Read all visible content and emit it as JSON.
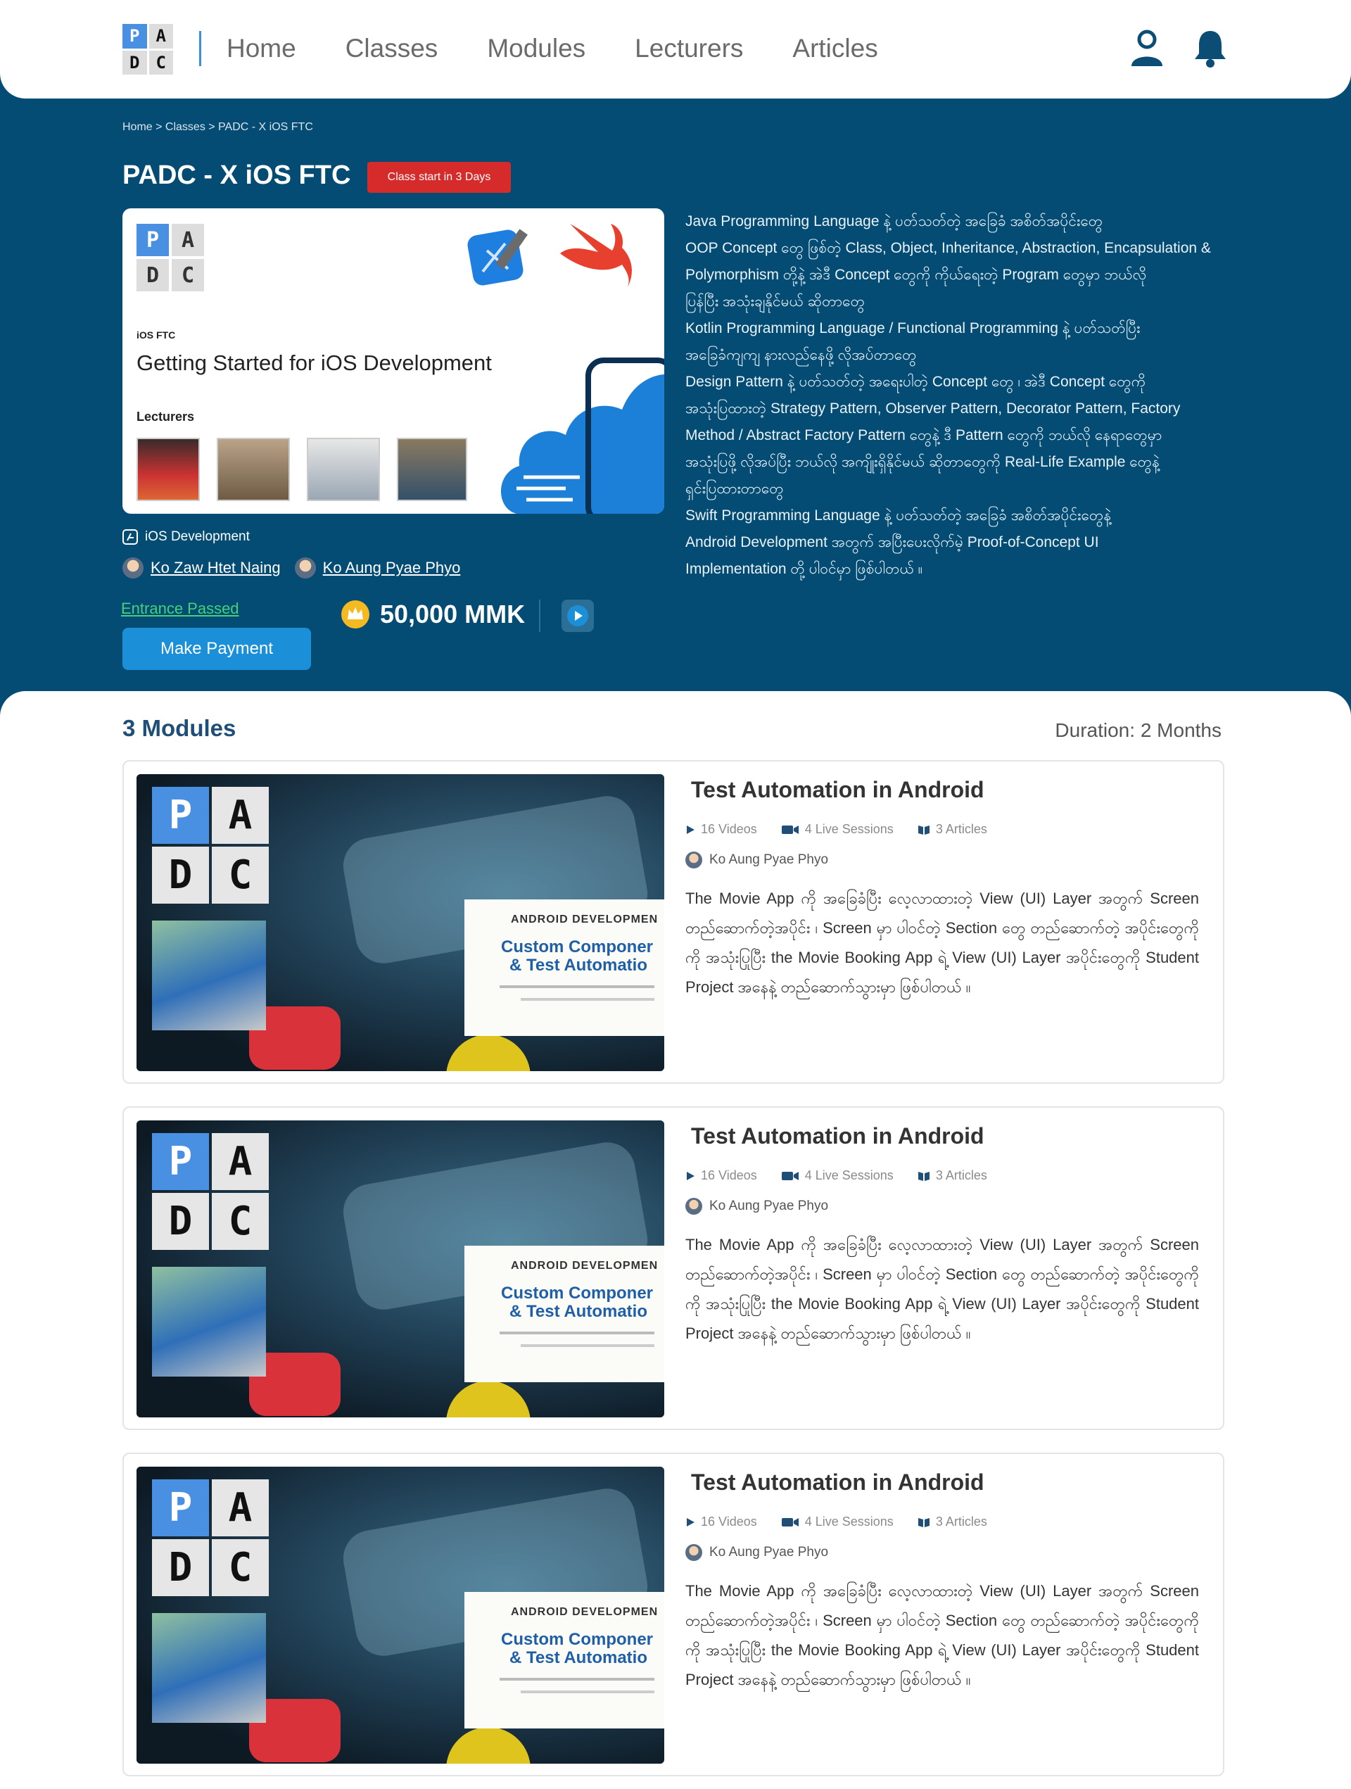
{
  "nav": {
    "logo_letters": [
      "P",
      "A",
      "D",
      "C"
    ],
    "items": [
      "Home",
      "Classes",
      "Modules",
      "Lecturers",
      "Articles"
    ],
    "profile_icon": "user-icon",
    "notification_icon": "bell-icon"
  },
  "breadcrumb": "Home > Classes > PADC - X iOS FTC",
  "class": {
    "title": "PADC - X iOS FTC",
    "badge": "Class start in 3 Days",
    "cover": {
      "subtitle": "iOS FTC",
      "title": "Getting Started for iOS Development",
      "lecturers_heading": "Lecturers"
    },
    "description_lines": [
      "Java Programming Language နဲ့ ပတ်သတ်တဲ့ အခြေခံ အစိတ်အပိုင်းတွေ",
      "OOP Concept တွေ ဖြစ်တဲ့ Class, Object, Inheritance, Abstraction, Encapsulation &",
      "Polymorphism တို့နဲ့ အဲဒီ Concept တွေကို ကိုယ်ရေးတဲ့ Program တွေမှာ ဘယ်လို",
      "ပြန်ပြီး အသုံးချနိုင်မယ် ဆိုတာတွေ",
      "Kotlin Programming Language / Functional Programming နဲ့ ပတ်သတ်ပြီး",
      "အခြေခံကျကျ နားလည်နေဖို့ လိုအပ်တာတွေ",
      "Design Pattern နဲ့ ပတ်သတ်တဲ့ အရေးပါတဲ့ Concept တွေ ၊ အဲဒီ Concept တွေကို",
      "အသုံးပြထားတဲ့ Strategy Pattern, Observer Pattern, Decorator Pattern, Factory",
      "Method / Abstract Factory Pattern တွေနဲ့ ဒီ Pattern တွေကို ဘယ်လို နေရာတွေမှာ",
      "အသုံးပြဖို့ လိုအပ်ပြီး ဘယ်လို အကျိုးရှိနိုင်မယ် ဆိုတာတွေကို Real-Life Example တွေနဲ့",
      "ရှင်းပြထားတာတွေ",
      "Swift Programming Language နဲ့ ပတ်သတ်တဲ့ အခြေခံ အစိတ်အပိုင်းတွေနဲ့",
      "Android Development အတွက် အပြီးပေးလိုက်မဲ့ Proof-of-Concept UI",
      "Implementation တို့ ပါဝင်မှာ ဖြစ်ပါတယ် ။"
    ],
    "category": "iOS Development",
    "lecturers": [
      "Ko Zaw Htet Naing",
      "Ko Aung Pyae Phyo"
    ],
    "entrance_status": "Entrance Passed",
    "price": "50,000 MMK",
    "pay_button": "Make Payment"
  },
  "modules": {
    "count_label": "3 Modules",
    "duration_label": "Duration: 2 Months",
    "items": [
      {
        "title": "Test Automation in Android",
        "videos": "16 Videos",
        "live": "4 Live Sessions",
        "articles": "3 Articles",
        "lecturer": "Ko Aung Pyae Phyo",
        "description": "The Movie App ကို အခြေခံပြီး လေ့လာထားတဲ့ View (UI) Layer အတွက် Screen တည်ဆောက်တဲ့အပိုင်း ၊ Screen မှာ ပါဝင်တဲ့ Section တွေ တည်ဆောက်တဲ့ အပိုင်းတွေကို ကို အသုံးပြုပြီး the Movie Booking App ရဲ့ View (UI) Layer အပိုင်းတွေကို Student Project အနေနဲ့ တည်ဆောက်သွားမှာ ဖြစ်ပါတယ် ။",
        "thumb_badge": "ANDROID DEVELOPMEN",
        "thumb_title1": "Custom Componer",
        "thumb_title2": "& Test Automatio"
      },
      {
        "title": "Test Automation in Android",
        "videos": "16 Videos",
        "live": "4 Live Sessions",
        "articles": "3 Articles",
        "lecturer": "Ko Aung Pyae Phyo",
        "description": "The Movie App ကို အခြေခံပြီး လေ့လာထားတဲ့ View (UI) Layer အတွက် Screen တည်ဆောက်တဲ့အပိုင်း ၊ Screen မှာ ပါဝင်တဲ့ Section တွေ တည်ဆောက်တဲ့ အပိုင်းတွေကို ကို အသုံးပြုပြီး the Movie Booking App ရဲ့ View (UI) Layer အပိုင်းတွေကို Student Project အနေနဲ့ တည်ဆောက်သွားမှာ ဖြစ်ပါတယ် ။",
        "thumb_badge": "ANDROID DEVELOPMEN",
        "thumb_title1": "Custom Componer",
        "thumb_title2": "& Test Automatio"
      },
      {
        "title": "Test Automation in Android",
        "videos": "16 Videos",
        "live": "4 Live Sessions",
        "articles": "3 Articles",
        "lecturer": "Ko Aung Pyae Phyo",
        "description": "The Movie App ကို အခြေခံပြီး လေ့လာထားတဲ့ View (UI) Layer အတွက် Screen တည်ဆောက်တဲ့အပိုင်း ၊ Screen မှာ ပါဝင်တဲ့ Section တွေ တည်ဆောက်တဲ့ အပိုင်းတွေကို ကို အသုံးပြုပြီး the Movie Booking App ရဲ့ View (UI) Layer အပိုင်းတွေကို Student Project အနေနဲ့ တည်ဆောက်သွားမှာ ဖြစ်ပါတယ် ။",
        "thumb_badge": "ANDROID DEVELOPMEN",
        "thumb_title1": "Custom Componer",
        "thumb_title2": "& Test Automatio"
      }
    ]
  }
}
